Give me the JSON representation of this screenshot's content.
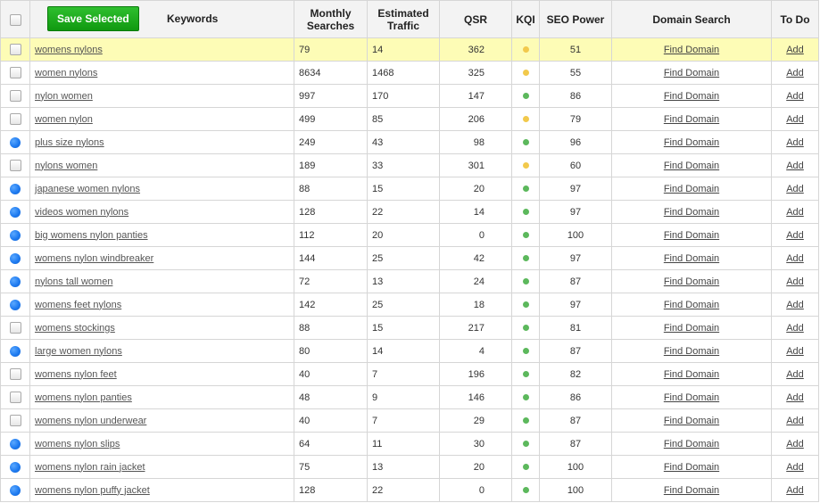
{
  "header": {
    "save_button": "Save Selected",
    "keywords": "Keywords",
    "monthly": "Monthly Searches",
    "traffic": "Estimated Traffic",
    "qsr": "QSR",
    "kqi": "KQI",
    "seo": "SEO Power",
    "domain": "Domain Search",
    "todo": "To Do"
  },
  "colors": {
    "kqi_yellow": "#f2c94c",
    "kqi_green": "#5cb85c",
    "highlight_row": "#fdfcb6",
    "save_button": "#109910"
  },
  "rows": [
    {
      "keyword": "womens nylons",
      "monthly": "79",
      "traffic": "14",
      "qsr": "362",
      "kqi": "yellow",
      "seo": "51",
      "domain": "Find Domain",
      "todo": "Add",
      "selected": false,
      "highlight": true
    },
    {
      "keyword": "women nylons",
      "monthly": "8634",
      "traffic": "1468",
      "qsr": "325",
      "kqi": "yellow",
      "seo": "55",
      "domain": "Find Domain",
      "todo": "Add",
      "selected": false
    },
    {
      "keyword": "nylon women",
      "monthly": "997",
      "traffic": "170",
      "qsr": "147",
      "kqi": "green",
      "seo": "86",
      "domain": "Find Domain",
      "todo": "Add",
      "selected": false
    },
    {
      "keyword": "women nylon",
      "monthly": "499",
      "traffic": "85",
      "qsr": "206",
      "kqi": "yellow",
      "seo": "79",
      "domain": "Find Domain",
      "todo": "Add",
      "selected": false
    },
    {
      "keyword": "plus size nylons",
      "monthly": "249",
      "traffic": "43",
      "qsr": "98",
      "kqi": "green",
      "seo": "96",
      "domain": "Find Domain",
      "todo": "Add",
      "selected": true
    },
    {
      "keyword": "nylons women",
      "monthly": "189",
      "traffic": "33",
      "qsr": "301",
      "kqi": "yellow",
      "seo": "60",
      "domain": "Find Domain",
      "todo": "Add",
      "selected": false
    },
    {
      "keyword": "japanese women nylons",
      "monthly": "88",
      "traffic": "15",
      "qsr": "20",
      "kqi": "green",
      "seo": "97",
      "domain": "Find Domain",
      "todo": "Add",
      "selected": true
    },
    {
      "keyword": "videos women nylons",
      "monthly": "128",
      "traffic": "22",
      "qsr": "14",
      "kqi": "green",
      "seo": "97",
      "domain": "Find Domain",
      "todo": "Add",
      "selected": true
    },
    {
      "keyword": "big womens nylon panties",
      "monthly": "112",
      "traffic": "20",
      "qsr": "0",
      "kqi": "green",
      "seo": "100",
      "domain": "Find Domain",
      "todo": "Add",
      "selected": true
    },
    {
      "keyword": "womens nylon windbreaker",
      "monthly": "144",
      "traffic": "25",
      "qsr": "42",
      "kqi": "green",
      "seo": "97",
      "domain": "Find Domain",
      "todo": "Add",
      "selected": true
    },
    {
      "keyword": "nylons tall women",
      "monthly": "72",
      "traffic": "13",
      "qsr": "24",
      "kqi": "green",
      "seo": "87",
      "domain": "Find Domain",
      "todo": "Add",
      "selected": true
    },
    {
      "keyword": "womens feet nylons",
      "monthly": "142",
      "traffic": "25",
      "qsr": "18",
      "kqi": "green",
      "seo": "97",
      "domain": "Find Domain",
      "todo": "Add",
      "selected": true
    },
    {
      "keyword": "womens stockings",
      "monthly": "88",
      "traffic": "15",
      "qsr": "217",
      "kqi": "green",
      "seo": "81",
      "domain": "Find Domain",
      "todo": "Add",
      "selected": false
    },
    {
      "keyword": "large women nylons",
      "monthly": "80",
      "traffic": "14",
      "qsr": "4",
      "kqi": "green",
      "seo": "87",
      "domain": "Find Domain",
      "todo": "Add",
      "selected": true
    },
    {
      "keyword": "womens nylon feet",
      "monthly": "40",
      "traffic": "7",
      "qsr": "196",
      "kqi": "green",
      "seo": "82",
      "domain": "Find Domain",
      "todo": "Add",
      "selected": false
    },
    {
      "keyword": "womens nylon panties",
      "monthly": "48",
      "traffic": "9",
      "qsr": "146",
      "kqi": "green",
      "seo": "86",
      "domain": "Find Domain",
      "todo": "Add",
      "selected": false
    },
    {
      "keyword": "womens nylon underwear",
      "monthly": "40",
      "traffic": "7",
      "qsr": "29",
      "kqi": "green",
      "seo": "87",
      "domain": "Find Domain",
      "todo": "Add",
      "selected": false
    },
    {
      "keyword": "womens nylon slips",
      "monthly": "64",
      "traffic": "11",
      "qsr": "30",
      "kqi": "green",
      "seo": "87",
      "domain": "Find Domain",
      "todo": "Add",
      "selected": true
    },
    {
      "keyword": "womens nylon rain jacket",
      "monthly": "75",
      "traffic": "13",
      "qsr": "20",
      "kqi": "green",
      "seo": "100",
      "domain": "Find Domain",
      "todo": "Add",
      "selected": true
    },
    {
      "keyword": "womens nylon puffy jacket",
      "monthly": "128",
      "traffic": "22",
      "qsr": "0",
      "kqi": "green",
      "seo": "100",
      "domain": "Find Domain",
      "todo": "Add",
      "selected": true
    }
  ]
}
